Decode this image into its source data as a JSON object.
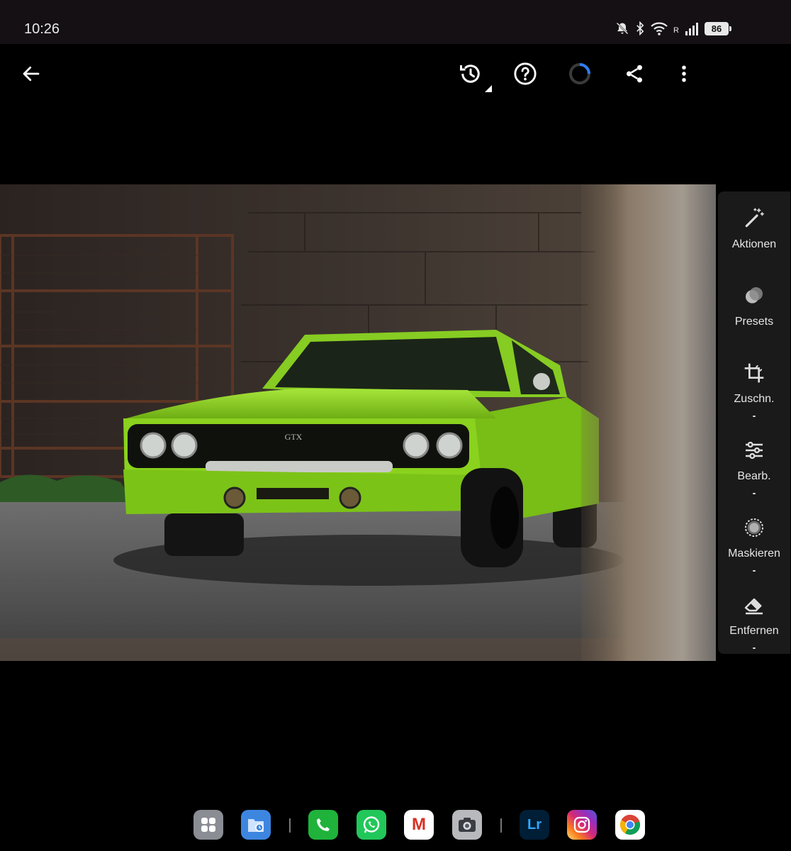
{
  "status": {
    "time": "10:26",
    "battery": "86",
    "signal_label": "R",
    "icons": [
      "bell-off-icon",
      "bluetooth-icon",
      "wifi-icon",
      "signal-icon",
      "battery-icon"
    ]
  },
  "toolbar": {
    "buttons": [
      "back-icon",
      "history-icon",
      "help-icon",
      "sync-progress-icon",
      "share-icon",
      "more-vert-icon"
    ]
  },
  "photo": {
    "badge_text": "GTX",
    "colors": {
      "car": "#8bd21f",
      "wall": "#3a302b",
      "ground": "#5b5b5b"
    }
  },
  "sidepanel": {
    "tools": [
      {
        "label": "Aktionen",
        "icon": "magic-wand-icon"
      },
      {
        "label": "Presets",
        "icon": "presets-icon"
      },
      {
        "label": "Zuschn.",
        "icon": "crop-icon"
      },
      {
        "label": "Bearb.",
        "icon": "sliders-icon"
      },
      {
        "label": "Maskieren",
        "icon": "mask-icon"
      },
      {
        "label": "Entfernen",
        "icon": "eraser-icon"
      }
    ]
  },
  "dock": {
    "apps": [
      {
        "name": "app-drawer",
        "label": ""
      },
      {
        "name": "files",
        "label": ""
      },
      {
        "name": "phone",
        "label": ""
      },
      {
        "name": "whatsapp",
        "label": ""
      },
      {
        "name": "gmail",
        "label": "M"
      },
      {
        "name": "camera",
        "label": ""
      },
      {
        "name": "lightroom",
        "label": "Lr"
      },
      {
        "name": "instagram",
        "label": ""
      },
      {
        "name": "chrome",
        "label": ""
      }
    ]
  }
}
